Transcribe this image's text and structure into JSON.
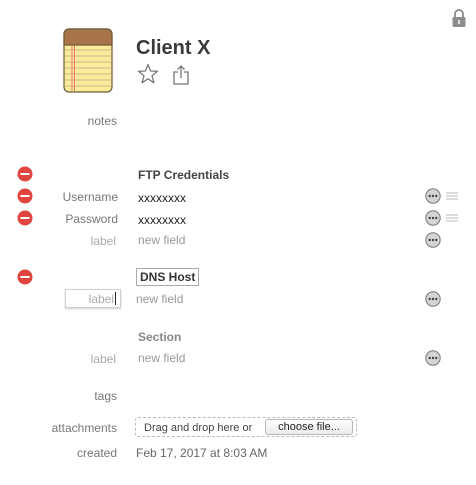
{
  "item": {
    "title": "Client X",
    "notes_label": "notes",
    "tags_label": "tags",
    "attachments_label": "attachments",
    "created_label": "created",
    "created_value": "Feb 17, 2017 at 8:03 AM",
    "dropzone_text": "Drag and drop here or",
    "choose_file_label": "choose file..."
  },
  "sections": [
    {
      "title": "FTP Credentials",
      "fields": [
        {
          "label": "Username",
          "value": "xxxxxxxx"
        },
        {
          "label": "Password",
          "value": "xxxxxxxx"
        }
      ],
      "new_field": {
        "label": "label",
        "placeholder": "new field"
      }
    },
    {
      "title": "DNS Host",
      "new_field": {
        "label": "label",
        "placeholder": "new field"
      }
    },
    {
      "title": "Section",
      "new_field": {
        "label": "label",
        "placeholder": "new field"
      }
    }
  ],
  "icons": {
    "lock": "lock-icon",
    "notepad": "notepad-icon",
    "star": "star-icon",
    "share": "share-icon",
    "remove": "remove-circle-icon",
    "more": "more-dots-icon",
    "reorder": "reorder-handle-icon"
  },
  "colors": {
    "remove": "#e0443e",
    "notepad_cover": "#a8744a",
    "notepad_paper": "#fbeb9c",
    "notepad_margin": "#e87b6a"
  }
}
